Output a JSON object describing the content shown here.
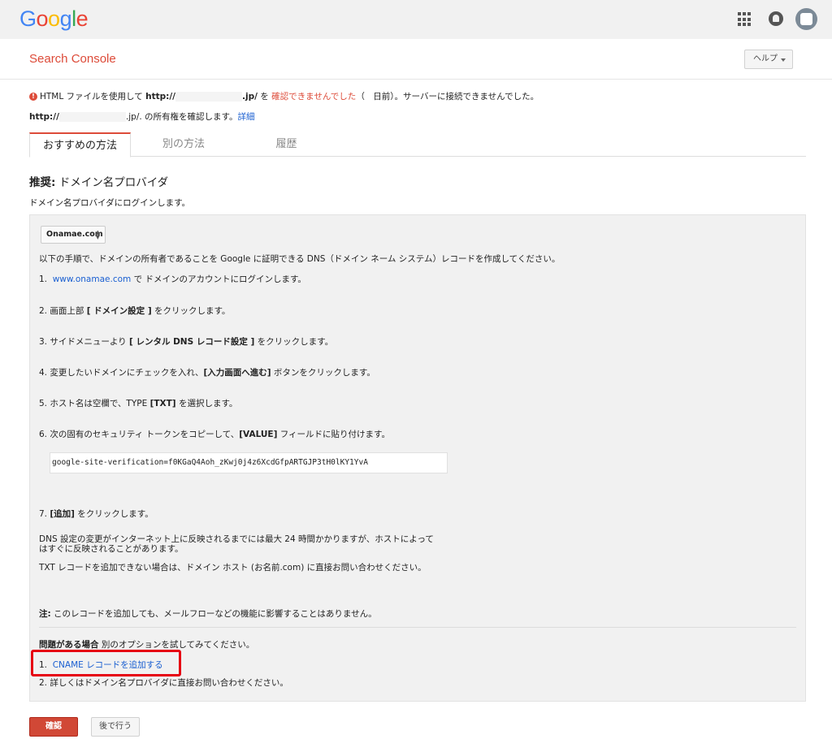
{
  "topbar": {
    "logo_letters": [
      {
        "ch": "G",
        "color": "#4285F4"
      },
      {
        "ch": "o",
        "color": "#EA4335"
      },
      {
        "ch": "o",
        "color": "#FBBC05"
      },
      {
        "ch": "g",
        "color": "#4285F4"
      },
      {
        "ch": "l",
        "color": "#34A853"
      },
      {
        "ch": "e",
        "color": "#EA4335"
      }
    ],
    "icons": [
      "apps-icon",
      "notifications-bell-icon",
      "account-avatar"
    ]
  },
  "header": {
    "title": "Search Console",
    "help_label": "ヘルプ"
  },
  "status": {
    "line1_a": "HTML ファイルを使用して",
    "line1_url_prefix": "http://",
    "line1_url_suffix": ".jp/",
    "line1_b": "を",
    "line1_red": "確認できませんでした",
    "line1_c": "（　日前）。サーバーに接続できませんでした。",
    "line2_url_prefix": "http://",
    "line2_url_suffix": ".jp/.",
    "line2_text": " の所有権を確認します。",
    "line2_link": "詳細"
  },
  "tabs": [
    {
      "label": "おすすめの方法"
    },
    {
      "label": "別の方法"
    },
    {
      "label": "履歴"
    }
  ],
  "section": {
    "title_bold": "推奨:",
    "title_rest": " ドメイン名プロバイダ",
    "login_note": "ドメイン名プロバイダにログインします。"
  },
  "panel": {
    "provider_selected": "Onamae.com",
    "intro": "以下の手順で、ドメインの所有者であることを Google に証明できる DNS（ドメイン ネーム システム）レコードを作成してください。",
    "step1_num": "1.",
    "step1_link": "www.onamae.com",
    "step1_rest": " で ドメインのアカウントにログインします。",
    "step2_a": "2.  画面上部 ",
    "step2_b": "[ ドメイン設定 ]",
    "step2_c": " をクリックします。",
    "step3_a": "3.  サイドメニューより ",
    "step3_b": "[ レンタル DNS レコード設定 ]",
    "step3_c": " をクリックします。",
    "step4_a": "4.  変更したいドメインにチェックを入れ、",
    "step4_b": "[入力画面へ進む]",
    "step4_c": " ボタンをクリックします。",
    "step5_a": "5.  ホスト名は空欄で、TYPE ",
    "step5_b": "[TXT]",
    "step5_c": " を選択します。",
    "step6_a": "6.  次の固有のセキュリティ トークンをコピーして、",
    "step6_b": "[VALUE]",
    "step6_c": " フィールドに貼り付けます。",
    "token": "google-site-verification=f0KGaQ4Aoh_zKwj0j4z6XcdGfpARTGJP3tH0lKY1YvA",
    "step7_a": "7.  ",
    "step7_b": "[追加]",
    "step7_c": " をクリックします。",
    "dns_note_1": "DNS 設定の変更がインターネット上に反映されるまでには最大 24 時間かかりますが、ホストによって",
    "dns_note_2": "はすぐに反映されることがあります。",
    "txt_note": "TXT レコードを追加できない場合は、ドメイン ホスト (お名前.com) に直接お問い合わせください。",
    "note_bold": "注:",
    "note_rest": " このレコードを追加しても、メールフローなどの機能に影響することはありません。",
    "problem_bold": "問題がある場合",
    "problem_rest": " 別のオプションを試してみてください。",
    "opt1_num": "1.",
    "opt1_link": "CNAME レコードを追加する",
    "opt2": "2.  詳しくはドメイン名プロバイダに直接お問い合わせください。"
  },
  "buttons": {
    "confirm": "確認",
    "later": "後で行う"
  }
}
